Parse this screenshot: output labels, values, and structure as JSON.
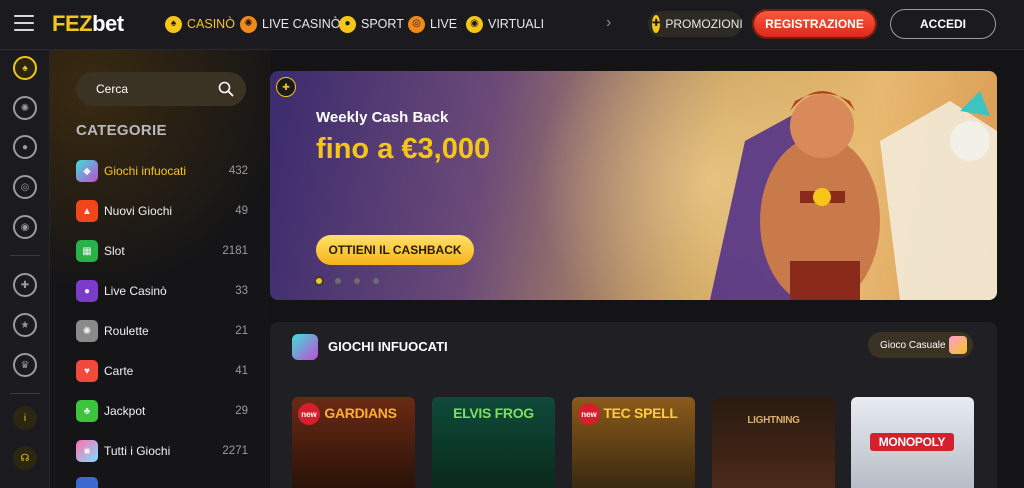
{
  "header": {
    "logo_part1": "FEZ",
    "logo_part2": "bet",
    "nav": [
      {
        "label": "CASINÒ",
        "icon": "spade-icon"
      },
      {
        "label": "LIVE CASINÒ",
        "icon": "roulette-icon"
      },
      {
        "label": "SPORT",
        "icon": "soccer-ball-icon"
      },
      {
        "label": "LIVE",
        "icon": "wifi-icon"
      },
      {
        "label": "VIRTUALI",
        "icon": "target-icon"
      }
    ],
    "promotions_label": "PROMOZIONI",
    "register_label": "REGISTRAZIONE",
    "login_label": "ACCEDI"
  },
  "sidebar": {
    "search_placeholder": "Cerca",
    "categories_title": "CATEGORIE",
    "categories": [
      {
        "label": "Giochi infuocati",
        "count": "432",
        "color": "#c24bd4"
      },
      {
        "label": "Nuovi Giochi",
        "count": "49",
        "color": "#f2451b"
      },
      {
        "label": "Slot",
        "count": "2181",
        "color": "#2ab24a"
      },
      {
        "label": "Live Casinò",
        "count": "33",
        "color": "#7b3cc9"
      },
      {
        "label": "Roulette",
        "count": "21",
        "color": "#8a8a8a"
      },
      {
        "label": "Carte",
        "count": "41",
        "color": "#f24a3a"
      },
      {
        "label": "Jackpot",
        "count": "29",
        "color": "#3cc43c"
      },
      {
        "label": "Tutti i Giochi",
        "count": "2271",
        "color": "#ff6fb0"
      }
    ]
  },
  "banner": {
    "subtitle": "Weekly Cash Back",
    "title": "fino a €3,000",
    "button_label": "OTTIENI IL CASHBACK"
  },
  "hot_games": {
    "title": "GIOCHI INFUOCATI",
    "casual_label": "Gioco Casuale",
    "games": [
      {
        "title": "GARDIANS",
        "bg": "#3a1a10",
        "title_color": "#ffb02e",
        "badge": "new"
      },
      {
        "title": "ELVIS FROG",
        "bg": "#0f3a2a",
        "title_color": "#7ee05a",
        "badge": ""
      },
      {
        "title": "TEC SPELL",
        "bg": "#5a3a10",
        "title_color": "#ffcc3e",
        "badge": "new"
      },
      {
        "title": "LIGHTNING",
        "bg": "#1a0e0a",
        "title_color": "#d8b070",
        "badge": ""
      },
      {
        "title": "MONOPOLY",
        "bg": "#d0d4dc",
        "title_color": "#ffffff",
        "badge": ""
      }
    ]
  }
}
